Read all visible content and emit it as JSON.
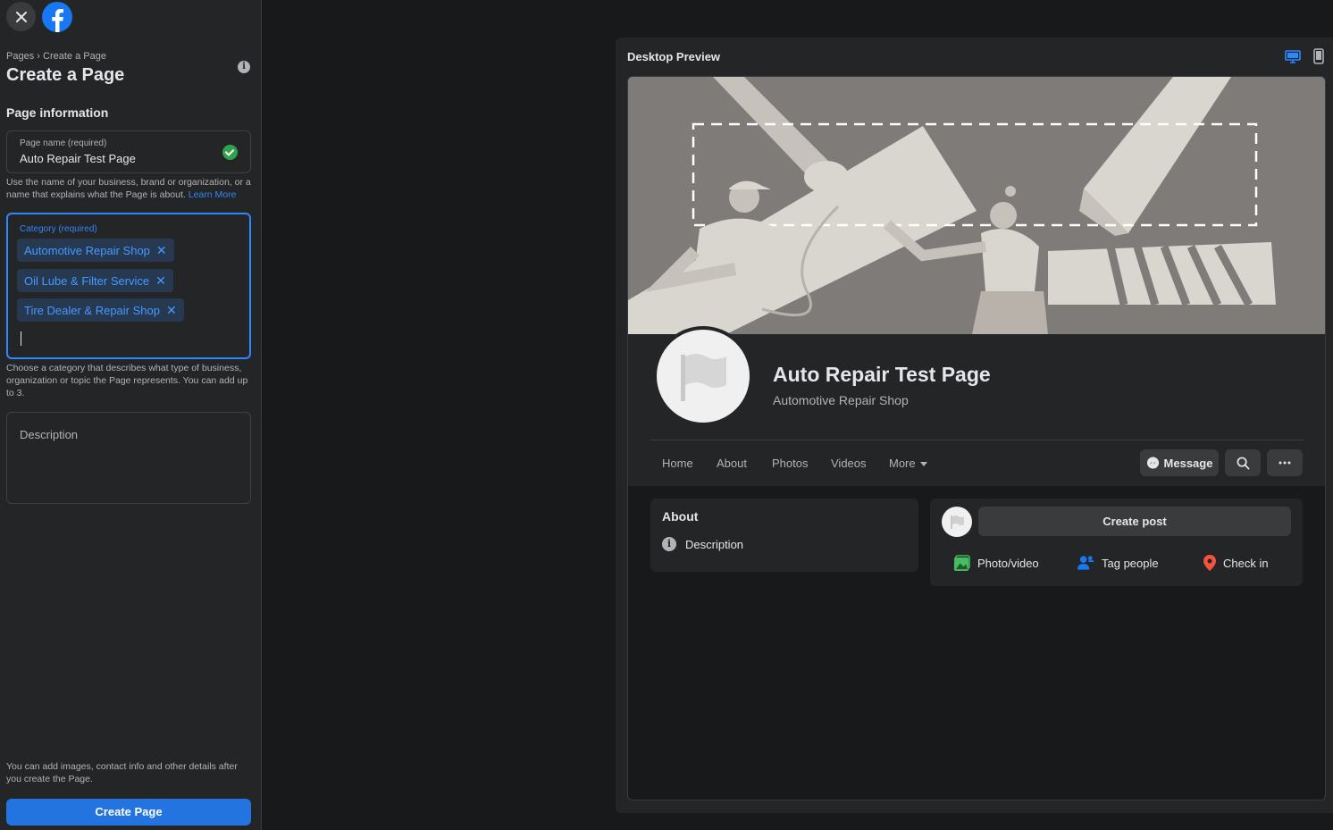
{
  "sidebar": {
    "breadcrumb": [
      "Pages",
      "Create a Page"
    ],
    "breadcrumb_sep": "›",
    "title": "Create a Page",
    "section_title": "Page information",
    "page_name": {
      "label": "Page name (required)",
      "value": "Auto Repair Test Page"
    },
    "page_name_help": "Use the name of your business, brand or organization, or a name that explains what the Page is about.",
    "learn_more": "Learn More",
    "category": {
      "label": "Category (required)",
      "chips": [
        "Automotive Repair Shop",
        "Oil Lube & Filter Service",
        "Tire Dealer & Repair Shop"
      ]
    },
    "category_help": "Choose a category that describes what type of business, organization or topic the Page represents. You can add up to 3.",
    "description_placeholder": "Description",
    "footer_note": "You can add images, contact info and other details after you create the Page.",
    "create_button": "Create Page"
  },
  "preview": {
    "title": "Desktop Preview",
    "page_name": "Auto Repair Test Page",
    "page_category": "Automotive Repair Shop",
    "tabs": [
      "Home",
      "About",
      "Photos",
      "Videos",
      "More"
    ],
    "message_button": "Message",
    "about": {
      "title": "About",
      "description": "Description"
    },
    "create_post": "Create post",
    "actions": [
      "Photo/video",
      "Tag people",
      "Check in"
    ]
  },
  "colors": {
    "accent": "#2d88ff",
    "button": "#2374e1",
    "success": "#31a24c",
    "background": "#18191a",
    "surface": "#242526"
  }
}
